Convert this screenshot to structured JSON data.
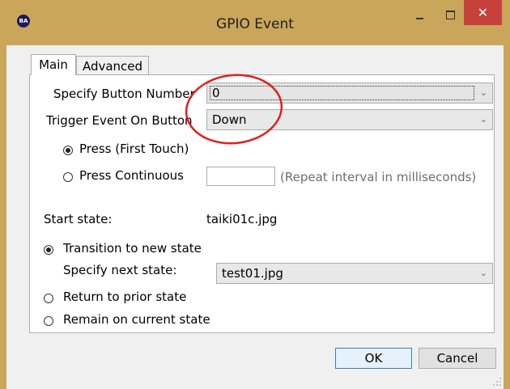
{
  "window": {
    "title": "GPIO Event",
    "app_icon_text": "BA",
    "close_glyph": "✕"
  },
  "tabs": [
    {
      "label": "Main",
      "selected": true
    },
    {
      "label": "Advanced",
      "selected": false
    }
  ],
  "main": {
    "button_number_label": "Specify Button Number",
    "button_number_value": "0",
    "trigger_label": "Trigger Event On Button",
    "trigger_value": "Down",
    "press_first_label": "Press (First Touch)",
    "press_continuous_label": "Press Continuous",
    "repeat_interval_value": "",
    "repeat_hint": "(Repeat interval in milliseconds)",
    "start_state_label": "Start state:",
    "start_state_value": "taiki01c.jpg",
    "transition_label": "Transition to new state",
    "next_state_label": "Specify next state:",
    "next_state_value": "test01.jpg",
    "return_label": "Return to prior state",
    "remain_label": "Remain on current state"
  },
  "buttons": {
    "ok": "OK",
    "cancel": "Cancel"
  },
  "colors": {
    "titlebar": "#c9a65a",
    "close": "#c7413c",
    "annotation": "#e02020"
  },
  "icons": {
    "app": "ba-logo-icon",
    "minimize": "minimize-icon",
    "maximize": "maximize-icon",
    "close": "close-icon",
    "dropdown": "chevron-down-icon"
  }
}
